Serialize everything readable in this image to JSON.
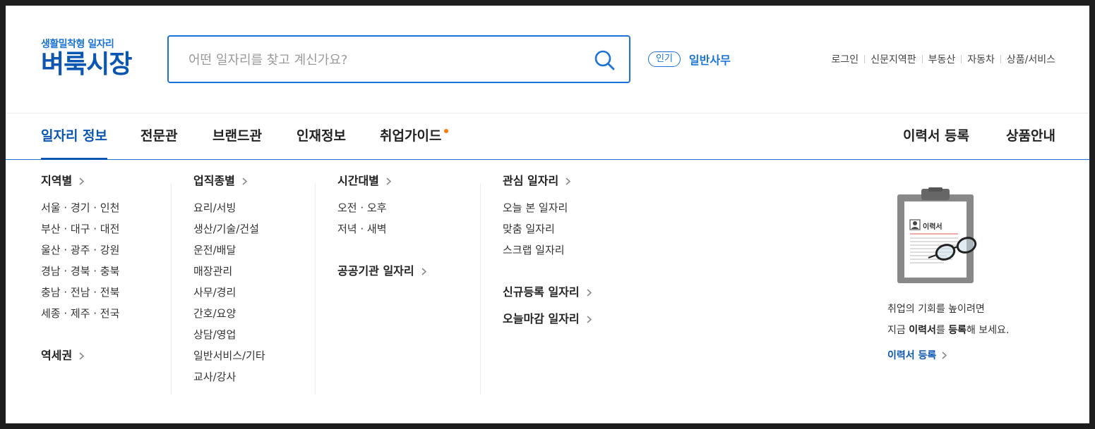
{
  "brand": {
    "tagline": "생활밀착형 일자리",
    "name": "벼룩시장"
  },
  "search": {
    "placeholder": "어떤 일자리를 찾고 계신가요?",
    "value": ""
  },
  "popular": {
    "badge": "인기",
    "keyword": "일반사무"
  },
  "util_links": [
    "로그인",
    "신문지역판",
    "부동산",
    "자동차",
    "상품/서비스"
  ],
  "nav": {
    "tabs": [
      "일자리 정보",
      "전문관",
      "브랜드관",
      "인재정보",
      "취업가이드"
    ],
    "active_tab": "일자리 정보",
    "right": [
      "이력서 등록",
      "상품안내"
    ]
  },
  "menu": {
    "region": {
      "heading": "지역별",
      "items": [
        "서울 · 경기 · 인천",
        "부산 · 대구 · 대전",
        "울산 · 광주 · 강원",
        "경남 · 경북 · 충북",
        "충남 · 전남 · 전북",
        "세종 · 제주 · 전국"
      ],
      "subheading": "역세권"
    },
    "occupation": {
      "heading": "업직종별",
      "items": [
        "요리/서빙",
        "생산/기술/건설",
        "운전/배달",
        "매장관리",
        "사무/경리",
        "간호/요양",
        "상담/영업",
        "일반서비스/기타",
        "교사/강사"
      ]
    },
    "time": {
      "heading": "시간대별",
      "items": [
        "오전 · 오후",
        "저녁 · 새벽"
      ],
      "subheading": "공공기관 일자리"
    },
    "interest": {
      "heading": "관심 일자리",
      "items": [
        "오늘 본 일자리",
        "맞춤 일자리",
        "스크랩 일자리"
      ],
      "extra": [
        "신규등록 일자리",
        "오늘마감 일자리"
      ]
    }
  },
  "promo": {
    "card_label": "이력서",
    "line1": "취업의 기회를 높이려면",
    "line2_prefix": "지금 ",
    "line2_bold1": "이력서",
    "line2_mid": "를 ",
    "line2_bold2": "등록",
    "line2_suffix": "해 보세요.",
    "link": "이력서 등록"
  },
  "colors": {
    "primary": "#1a73d9",
    "primary_dark": "#0b56b3",
    "accent_dot": "#ff7a00"
  }
}
